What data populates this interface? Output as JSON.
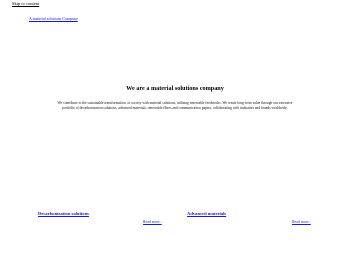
{
  "header": {
    "skip_link": "Skip to content",
    "logo_text": "A material solutions Company"
  },
  "hero": {
    "title": "We are a material solutions company",
    "description": "We contribute to the sustainable transformation, of society with material solutions, utilising renewable feedstocks. We create long-term value through our extensive portfolio of decarbonization solutions, advanced materials, renewable fibres and communication papers, collaborating with industries and brands worldwide."
  },
  "cards": [
    {
      "title": "Decarbonization solutions",
      "link": "Read more ›"
    },
    {
      "title": "Advanced materials",
      "link": "Read more ›"
    }
  ],
  "colors": {
    "link": "#1a1ad6",
    "text": "#000000",
    "background": "#ffffff"
  }
}
